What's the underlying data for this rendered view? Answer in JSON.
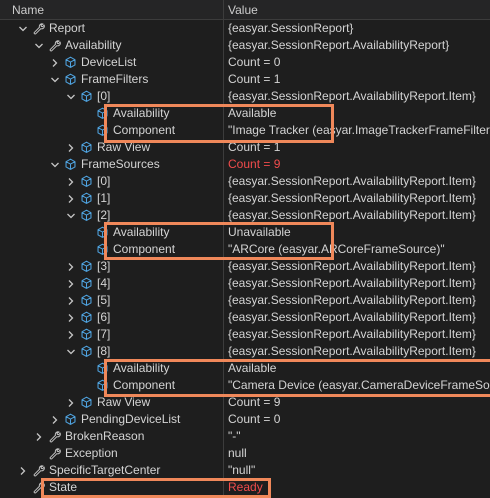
{
  "header": {
    "name": "Name",
    "value": "Value"
  },
  "rows": [
    {
      "label": "Report",
      "value": "{easyar.SessionReport}",
      "indent": 0,
      "chev": "open",
      "icon": "wrench"
    },
    {
      "label": "Availability",
      "value": "{easyar.SessionReport.AvailabilityReport}",
      "indent": 1,
      "chev": "open",
      "icon": "wrench"
    },
    {
      "label": "DeviceList",
      "value": "Count = 0",
      "indent": 2,
      "chev": "closed",
      "icon": "cube"
    },
    {
      "label": "FrameFilters",
      "value": "Count = 1",
      "indent": 2,
      "chev": "open",
      "icon": "cube"
    },
    {
      "label": "[0]",
      "value": "{easyar.SessionReport.AvailabilityReport.Item}",
      "indent": 3,
      "chev": "open",
      "icon": "cube"
    },
    {
      "label": "Availability",
      "value": "Available",
      "indent": 4,
      "chev": "none",
      "icon": "cube"
    },
    {
      "label": "Component",
      "value": "\"Image Tracker (easyar.ImageTrackerFrameFilter)\"",
      "indent": 4,
      "chev": "none",
      "icon": "cube"
    },
    {
      "label": "Raw View",
      "value": "Count = 1",
      "indent": 3,
      "chev": "closed",
      "icon": "cube"
    },
    {
      "label": "FrameSources",
      "value": "Count = 9",
      "indent": 2,
      "chev": "open",
      "icon": "cube",
      "valueColor": "red"
    },
    {
      "label": "[0]",
      "value": "{easyar.SessionReport.AvailabilityReport.Item}",
      "indent": 3,
      "chev": "closed",
      "icon": "cube"
    },
    {
      "label": "[1]",
      "value": "{easyar.SessionReport.AvailabilityReport.Item}",
      "indent": 3,
      "chev": "closed",
      "icon": "cube"
    },
    {
      "label": "[2]",
      "value": "{easyar.SessionReport.AvailabilityReport.Item}",
      "indent": 3,
      "chev": "open",
      "icon": "cube"
    },
    {
      "label": "Availability",
      "value": "Unavailable",
      "indent": 4,
      "chev": "none",
      "icon": "cube"
    },
    {
      "label": "Component",
      "value": "\"ARCore (easyar.ARCoreFrameSource)\"",
      "indent": 4,
      "chev": "none",
      "icon": "cube"
    },
    {
      "label": "[3]",
      "value": "{easyar.SessionReport.AvailabilityReport.Item}",
      "indent": 3,
      "chev": "closed",
      "icon": "cube"
    },
    {
      "label": "[4]",
      "value": "{easyar.SessionReport.AvailabilityReport.Item}",
      "indent": 3,
      "chev": "closed",
      "icon": "cube"
    },
    {
      "label": "[5]",
      "value": "{easyar.SessionReport.AvailabilityReport.Item}",
      "indent": 3,
      "chev": "closed",
      "icon": "cube"
    },
    {
      "label": "[6]",
      "value": "{easyar.SessionReport.AvailabilityReport.Item}",
      "indent": 3,
      "chev": "closed",
      "icon": "cube"
    },
    {
      "label": "[7]",
      "value": "{easyar.SessionReport.AvailabilityReport.Item}",
      "indent": 3,
      "chev": "closed",
      "icon": "cube"
    },
    {
      "label": "[8]",
      "value": "{easyar.SessionReport.AvailabilityReport.Item}",
      "indent": 3,
      "chev": "open",
      "icon": "cube"
    },
    {
      "label": "Availability",
      "value": "Available",
      "indent": 4,
      "chev": "none",
      "icon": "cube"
    },
    {
      "label": "Component",
      "value": "\"Camera Device (easyar.CameraDeviceFrameSource)\"",
      "indent": 4,
      "chev": "none",
      "icon": "cube"
    },
    {
      "label": "Raw View",
      "value": "Count = 9",
      "indent": 3,
      "chev": "closed",
      "icon": "cube"
    },
    {
      "label": "PendingDeviceList",
      "value": "Count = 0",
      "indent": 2,
      "chev": "closed",
      "icon": "cube"
    },
    {
      "label": "BrokenReason",
      "value": "\"-\"",
      "indent": 1,
      "chev": "closed",
      "icon": "wrench"
    },
    {
      "label": "Exception",
      "value": "null",
      "indent": 1,
      "chev": "none",
      "icon": "wrench"
    },
    {
      "label": "SpecificTargetCenter",
      "value": "\"null\"",
      "indent": 0,
      "chev": "closed",
      "icon": "wrench"
    },
    {
      "label": "State",
      "value": "Ready",
      "indent": 0,
      "chev": "none",
      "icon": "wrench",
      "valueColor": "red"
    }
  ],
  "colors": {
    "highlight": "#f0885a",
    "changed_value": "#f14c4c",
    "cube_icon": "#4fa3e0"
  },
  "icons": {
    "wrench": "wrench-icon",
    "cube": "cube-icon",
    "open": "chevron-down-icon",
    "closed": "chevron-right-icon"
  }
}
